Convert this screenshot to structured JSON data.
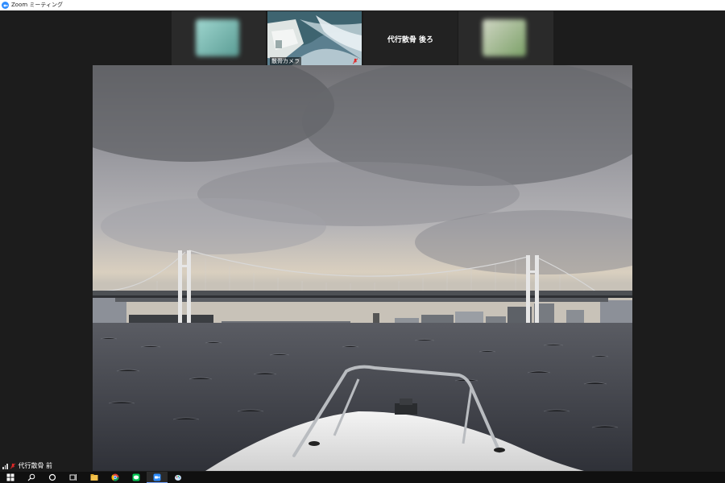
{
  "window": {
    "title": "Zoom ミーティング",
    "app_icon": "zoom-icon"
  },
  "gallery": {
    "tiles": [
      {
        "id": "participant-1",
        "blurred": true
      },
      {
        "id": "participant-2",
        "name": "散骨カメラ",
        "muted": true
      },
      {
        "id": "participant-3",
        "name": "代行散骨 後ろ",
        "video": false
      },
      {
        "id": "participant-4",
        "blurred": true
      }
    ]
  },
  "main_video": {
    "scene": "bridge-over-bay-from-boat-bow"
  },
  "self_view": {
    "name": "代行散骨 前",
    "muted": true,
    "signal_icon": "signal-bars-icon"
  },
  "taskbar": {
    "items": [
      {
        "icon": "windows-start-icon"
      },
      {
        "icon": "search-icon"
      },
      {
        "icon": "cortana-icon"
      },
      {
        "icon": "task-view-icon"
      },
      {
        "icon": "file-explorer-icon"
      },
      {
        "icon": "chrome-icon"
      },
      {
        "icon": "line-icon"
      },
      {
        "icon": "zoom-icon",
        "active": true
      },
      {
        "icon": "paint-icon"
      }
    ]
  },
  "colors": {
    "zoom_blue": "#2d8cff",
    "mute_red": "#e02828",
    "background": "#1c1c1c"
  }
}
